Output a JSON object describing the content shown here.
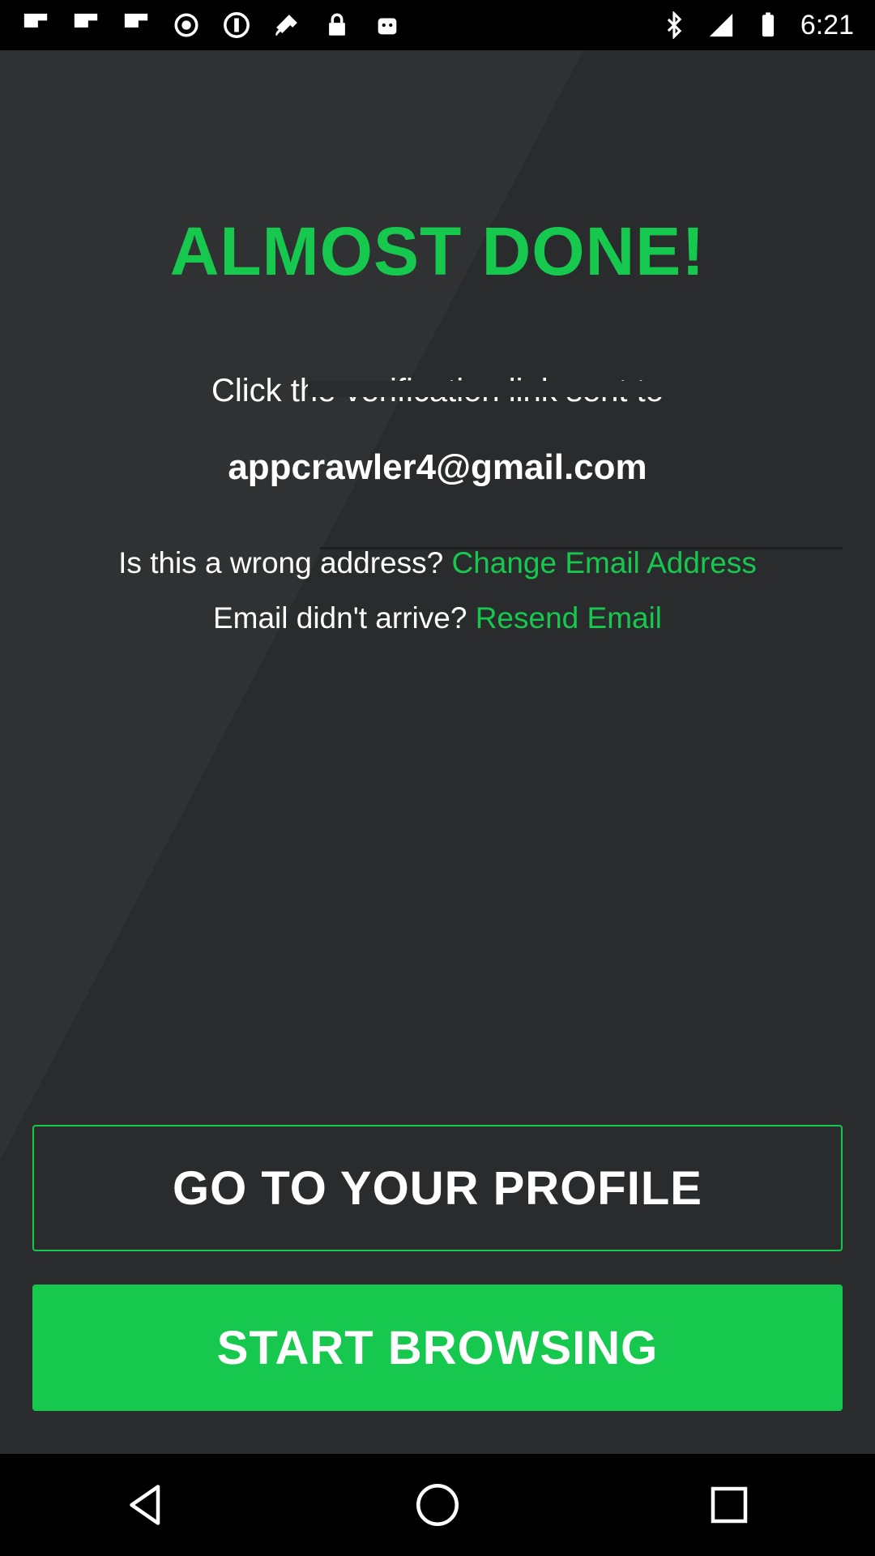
{
  "status_bar": {
    "time": "6:21",
    "left_icons": [
      "flipboard-icon",
      "flipboard-icon",
      "flipboard-icon",
      "record-icon",
      "flipboard-icon",
      "satellite-icon",
      "lock-icon",
      "android-icon"
    ],
    "right_icons": [
      "bluetooth-icon",
      "signal-icon",
      "battery-icon"
    ]
  },
  "main": {
    "title": "ALMOST DONE!",
    "instruction": "Click the verification link sent to",
    "email": "appcrawler4@gmail.com",
    "wrong_address_text": "Is this a wrong address?",
    "change_email_link": "Change Email Address",
    "not_arrived_text": "Email didn't arrive?",
    "resend_link": "Resend Email"
  },
  "buttons": {
    "profile_label": "GO TO YOUR PROFILE",
    "browse_label": "START BROWSING"
  },
  "nav_bar": {
    "back": "back-icon",
    "home": "home-icon",
    "recents": "recents-icon"
  },
  "colors": {
    "accent": "#16c94e",
    "background": "#2a2b2c",
    "text": "#ffffff"
  }
}
